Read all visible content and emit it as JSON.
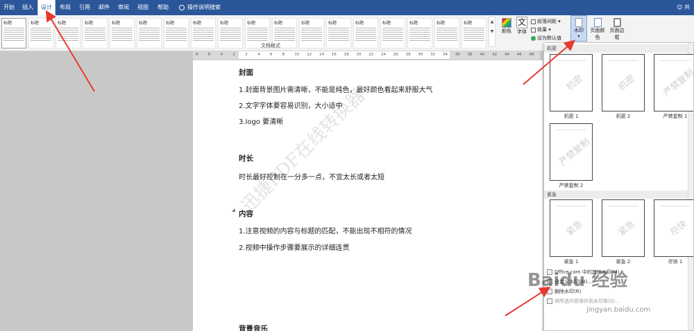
{
  "tabs": [
    "开始",
    "插入",
    "设计",
    "布局",
    "引用",
    "邮件",
    "审阅",
    "视图",
    "帮助"
  ],
  "tell_me": "操作说明搜索",
  "user": "共",
  "ribbon": {
    "style_thumbs": [
      "标题",
      "标题",
      "标题",
      "标题",
      "标题",
      "标题",
      "标题",
      "标题",
      "标题",
      "标题",
      "标题",
      "标题",
      "标题",
      "标题",
      "标题",
      "标题",
      "标题",
      "标题"
    ],
    "styles_group_label": "文档格式",
    "colors_label": "颜色",
    "fonts_label": "字体",
    "fonts_glyph": "文",
    "paragraph_spacing_label": "段落间距",
    "effects_label": "效果",
    "set_default_label": "设为默认值",
    "watermark_label": "水印",
    "page_color_label": "页面颜色",
    "page_border_label": "页面边框"
  },
  "ruler_ticks": [
    "8",
    "6",
    "4",
    "2",
    "2",
    "4",
    "6",
    "8",
    "10",
    "12",
    "14",
    "16",
    "18",
    "20",
    "22",
    "24",
    "26",
    "28",
    "30",
    "32",
    "34",
    "36",
    "38",
    "40",
    "42",
    "44",
    "46",
    "48"
  ],
  "document": {
    "lines": [
      {
        "text": "封面",
        "heading": true
      },
      {
        "text": "1.封面背景图片需清晰，不能是纯色，最好颜色看起来舒服大气",
        "heading": false
      },
      {
        "text": "2.文字字体要容易识别，大小适中",
        "heading": false
      },
      {
        "text": "3.logo 要清晰",
        "heading": false
      },
      {
        "text": "时长",
        "heading": true
      },
      {
        "text": "时长最好控制在一分多一点，不宜太长或者太短",
        "heading": false
      },
      {
        "text": "内容",
        "heading": true
      },
      {
        "text": "1.注意视频的内容与标题的匹配，不能出现不相符的情况",
        "heading": false
      },
      {
        "text": "2.视频中操作步骤要展示的详细连贯",
        "heading": false
      },
      {
        "text": "背景音乐",
        "heading": true
      }
    ],
    "watermark_text": "迅捷PDF在线转换器"
  },
  "watermark_panel": {
    "section_confidential": "机密",
    "section_urgent": "紧急",
    "items": [
      {
        "word": "机密",
        "label": "机密 1"
      },
      {
        "word": "机密",
        "label": "机密 2"
      },
      {
        "word": "严禁复制",
        "label": "严禁复制 1"
      },
      {
        "word": "严禁复制",
        "label": "严禁复制 2"
      },
      {
        "word": "紧急",
        "label": "紧急 1"
      },
      {
        "word": "紧急",
        "label": "紧急 2"
      },
      {
        "word": "尽快",
        "label": "尽快 1"
      }
    ],
    "menu_office": "Office.com 中的其他水印(M)",
    "menu_custom": "自定义水印(W)...",
    "menu_remove": "删除水印(R)",
    "menu_save": "将所选内容保存到水印库(S)..."
  },
  "overlay": {
    "baidu_logo": "Baidu 经验",
    "baidu_url": "jingyan.baidu.com"
  },
  "colors": {
    "tab_bar": "#2b579a",
    "arrow": "#e8392f"
  }
}
